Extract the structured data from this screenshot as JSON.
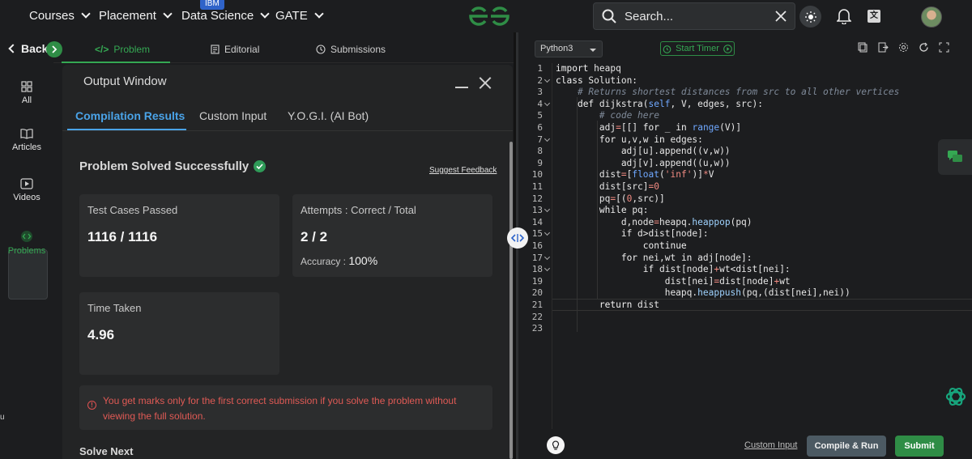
{
  "nav": {
    "items": [
      "Courses",
      "Placement",
      "Data Science",
      "GATE"
    ],
    "badge": "IBM",
    "search_placeholder": "Search..."
  },
  "sidebar": {
    "back_label": "Back",
    "items": [
      "All",
      "Articles",
      "Videos",
      "Problems"
    ]
  },
  "problem_tabs": [
    "Problem",
    "Editorial",
    "Submissions"
  ],
  "output": {
    "title": "Output Window",
    "tabs": [
      "Compilation Results",
      "Custom Input",
      "Y.O.G.I. (AI Bot)"
    ],
    "status": "Problem Solved Successfully",
    "feedback": "Suggest Feedback",
    "test_cases_label": "Test Cases Passed",
    "test_cases_value": "1116 / 1116",
    "attempts_label": "Attempts : Correct / Total",
    "attempts_value": "2 / 2",
    "accuracy_label": "Accuracy :",
    "accuracy_value": "100%",
    "time_label": "Time Taken",
    "time_value": "4.96",
    "notice": "You get marks only for the first correct submission if you solve the problem without viewing the full solution.",
    "solve_next": "Solve Next"
  },
  "editor": {
    "language": "Python3",
    "timer_label": "Start Timer",
    "lines": [
      "import heapq",
      "class Solution:",
      "    # Returns shortest distances from src to all other vertices",
      "    def dijkstra(self, V, edges, src):",
      "        # code here",
      "        adj=[[] for _ in range(V)]",
      "        for u,v,w in edges:",
      "            adj[u].append((v,w))",
      "            adj[v].append((u,w))",
      "        dist=[float('inf')]*V",
      "        dist[src]=0",
      "        pq=[(0,src)]",
      "        while pq:",
      "            d,node=heapq.heappop(pq)",
      "            if d>dist[node]:",
      "                continue",
      "            for nei,wt in adj[node]:",
      "                if dist[node]+wt<dist[nei]:",
      "                    dist[nei]=dist[node]+wt",
      "                    heapq.heappush(pq,(dist[nei],nei))",
      "        return dist",
      "",
      ""
    ],
    "line_numbers": [
      "1",
      "2",
      "3",
      "4",
      "5",
      "6",
      "7",
      "8",
      "9",
      "10",
      "11",
      "12",
      "13",
      "14",
      "15",
      "16",
      "17",
      "18",
      "19",
      "20",
      "21",
      "22",
      "23"
    ]
  },
  "bottom": {
    "custom_input": "Custom Input",
    "compile": "Compile & Run",
    "submit": "Submit"
  },
  "colors": {
    "accent_green": "#2f8d46",
    "accent_blue": "#4aa3e8",
    "error_red": "#e05a55"
  }
}
